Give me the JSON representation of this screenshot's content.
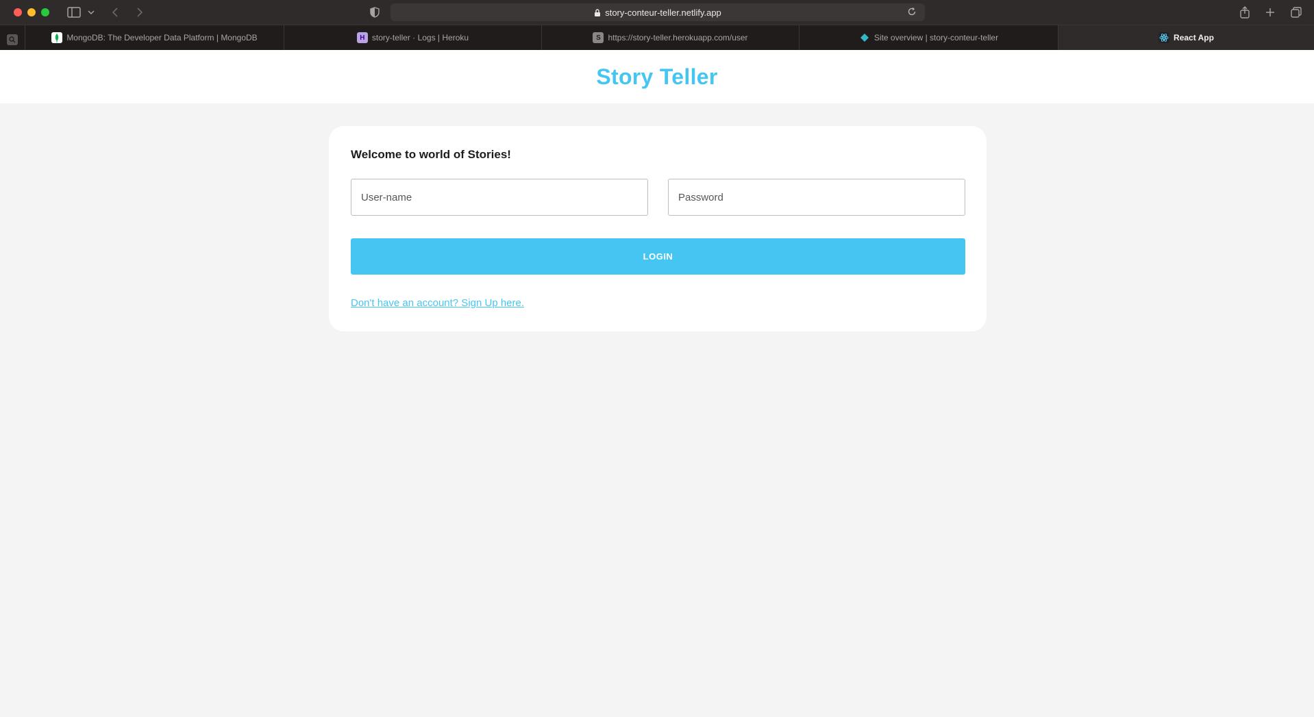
{
  "browser": {
    "url": "story-conteur-teller.netlify.app",
    "tabs": [
      {
        "title": "MongoDB: The Developer Data Platform | MongoDB",
        "favicon": "mongodb-leaf-icon",
        "active": false
      },
      {
        "title": "story-teller · Logs | Heroku",
        "favicon": "heroku-icon",
        "fav_text": "H",
        "active": false
      },
      {
        "title": "https://story-teller.herokuapp.com/user",
        "favicon": "s-letter-icon",
        "fav_text": "S",
        "active": false
      },
      {
        "title": "Site overview | story-conteur-teller",
        "favicon": "netlify-diamond-icon",
        "active": false
      },
      {
        "title": "React App",
        "favicon": "react-icon",
        "active": true
      }
    ]
  },
  "app": {
    "title": "Story Teller",
    "brand_color": "#45c6f2"
  },
  "login": {
    "welcome": "Welcome to world of Stories!",
    "username_placeholder": "User-name",
    "password_placeholder": "Password",
    "login_label": "LOGIN",
    "signup_link": "Don't have an account? Sign Up here."
  }
}
